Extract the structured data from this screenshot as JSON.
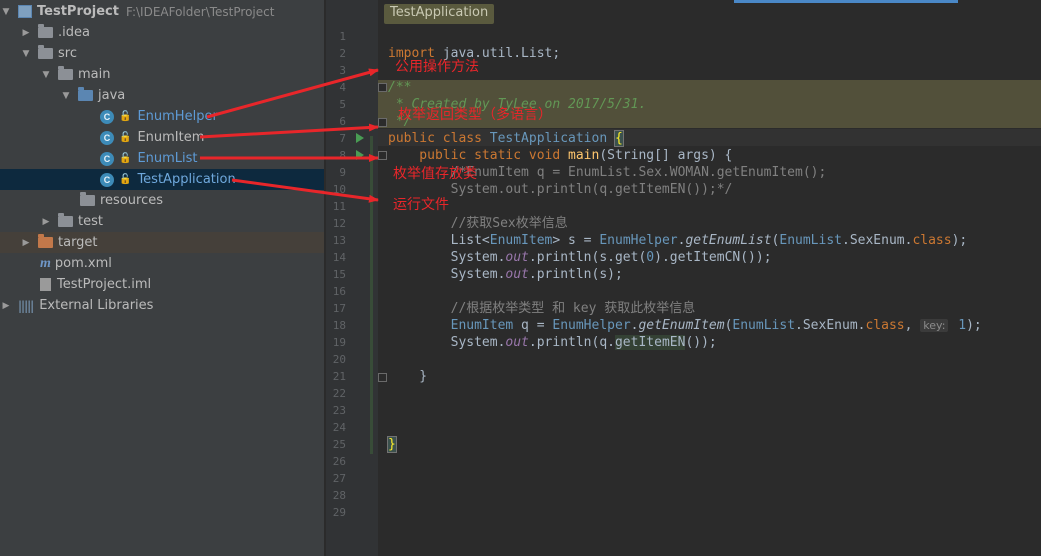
{
  "project": {
    "name": "TestProject",
    "path": "F:\\IDEAFolder\\TestProject",
    "items": [
      {
        "label": ".idea"
      },
      {
        "label": "src"
      },
      {
        "label": "main"
      },
      {
        "label": "java"
      },
      {
        "label": "EnumHelper"
      },
      {
        "label": "EnumItem"
      },
      {
        "label": "EnumList"
      },
      {
        "label": "TestApplication"
      },
      {
        "label": "resources"
      },
      {
        "label": "test"
      },
      {
        "label": "target"
      },
      {
        "label": "pom.xml"
      },
      {
        "label": "TestProject.iml"
      },
      {
        "label": "External Libraries"
      }
    ],
    "selected_item": "TestApplication"
  },
  "editor": {
    "breadcrumb": "TestApplication",
    "line_numbers": [
      "1",
      "2",
      "3",
      "4",
      "5",
      "6",
      "7",
      "8",
      "9",
      "10",
      "11",
      "12",
      "13",
      "14",
      "15",
      "16",
      "17",
      "18",
      "19",
      "20",
      "21",
      "22",
      "23",
      "24",
      "25",
      "26",
      "27",
      "28",
      "29"
    ],
    "code": {
      "l2_import": "import",
      "l2_pkg": " java.util.List;",
      "l4": "/**",
      "l5": " * Created by TyLee on 2017/5/31.",
      "l6": " */",
      "l7_kw": "public class ",
      "l7_name": "TestApplication ",
      "l7_brace": "{",
      "l8_kw": "    public static void ",
      "l8_name": "main",
      "l8_rest": "(String[] args) {",
      "l9": "        /*EnumItem q = EnumList.Sex.WOMAN.getEnumItem();",
      "l10": "        System.out.println(q.getItemEN());*/",
      "l12": "        //获取Sex枚举信息",
      "l13_a": "        List<",
      "l13_b": "EnumItem",
      "l13_c": "> s = ",
      "l13_d": "EnumHelper",
      "l13_e": ".",
      "l13_f": "getEnumList",
      "l13_g": "(",
      "l13_h": "EnumList",
      "l13_i": ".SexEnum.",
      "l13_j": "class",
      "l13_k": ");",
      "l14_a": "        System.",
      "l14_b": "out",
      "l14_c": ".println(s.get(",
      "l14_d": "0",
      "l14_e": ").getItemCN());",
      "l15_a": "        System.",
      "l15_b": "out",
      "l15_c": ".println(s);",
      "l17": "        //根据枚举类型 和 key 获取此枚举信息",
      "l18_a": "        EnumItem",
      "l18_b": " q = ",
      "l18_c": "EnumHelper",
      "l18_d": ".",
      "l18_e": "getEnumItem",
      "l18_f": "(",
      "l18_g": "EnumList",
      "l18_h": ".SexEnum.",
      "l18_i": "class",
      "l18_j": ", ",
      "l18_hint": "key:",
      "l18_k": " 1",
      "l18_l": ");",
      "l19_a": "        System.",
      "l19_b": "out",
      "l19_c": ".println(q.",
      "l19_d": "getItemEN",
      "l19_e": "());",
      "l21": "    }",
      "l25": "}"
    }
  },
  "annotations": [
    {
      "text": "公用操作方法"
    },
    {
      "text": "枚举返回类型（多语言）"
    },
    {
      "text": "枚举值存放类"
    },
    {
      "text": "运行文件"
    }
  ],
  "colors": {
    "tree_bg": "#3C3F41",
    "editor_bg": "#2B2B2B",
    "annotation": "#E8262A",
    "keyword": "#CC7832",
    "comment": "#808080",
    "doc_comment": "#629755",
    "type": "#6897BB",
    "method": "#FFC66D",
    "static_field": "#9876AA"
  }
}
